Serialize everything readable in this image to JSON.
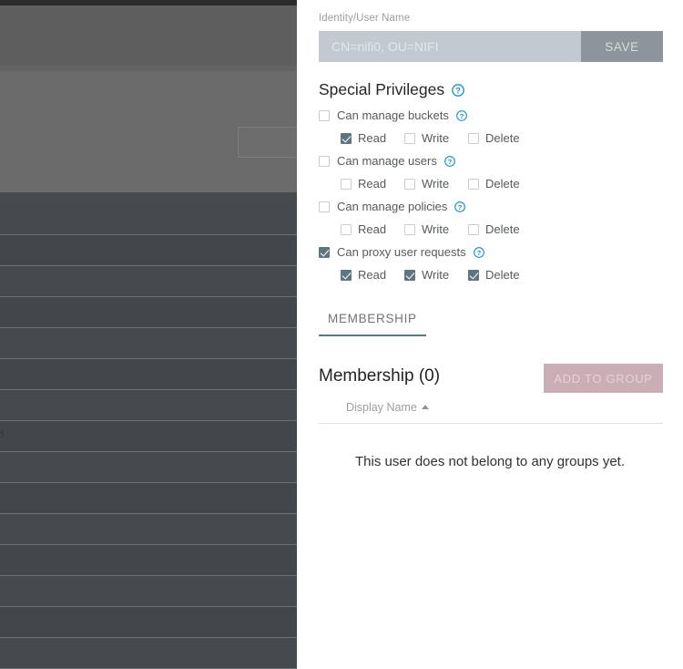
{
  "backdrop": {
    "row_sample_text": "d",
    "rows": 15
  },
  "panel": {
    "identity": {
      "label": "Identity/User Name",
      "value": "CN=nifi0, OU=NIFI",
      "placeholder": "CN=nifi0, OU=NIFI",
      "save_label": "SAVE"
    },
    "special_privileges": {
      "title": "Special Privileges",
      "help_icon": "help-circle-icon",
      "sub_labels": {
        "read": "Read",
        "write": "Write",
        "delete": "Delete"
      },
      "groups": [
        {
          "label": "Can manage buckets",
          "checked": false,
          "read": true,
          "write": false,
          "delete": false
        },
        {
          "label": "Can manage users",
          "checked": false,
          "read": false,
          "write": false,
          "delete": false
        },
        {
          "label": "Can manage policies",
          "checked": false,
          "read": false,
          "write": false,
          "delete": false
        },
        {
          "label": "Can proxy user requests",
          "checked": true,
          "read": true,
          "write": true,
          "delete": true
        }
      ]
    },
    "tabs": [
      {
        "label": "MEMBERSHIP",
        "active": true
      }
    ],
    "membership": {
      "heading": "Membership (0)",
      "add_button_label": "ADD TO GROUP",
      "columns": [
        {
          "label": "Display Name",
          "sort": "asc"
        }
      ],
      "rows": [],
      "empty_message": "This user does not belong to any groups yet."
    }
  },
  "colors": {
    "accent": "#5f7682",
    "help_icon": "#1a8fc4",
    "input_bg": "#c3c9d1",
    "save_bg": "#8e949c",
    "add_group_bg": "#cbadb5"
  }
}
